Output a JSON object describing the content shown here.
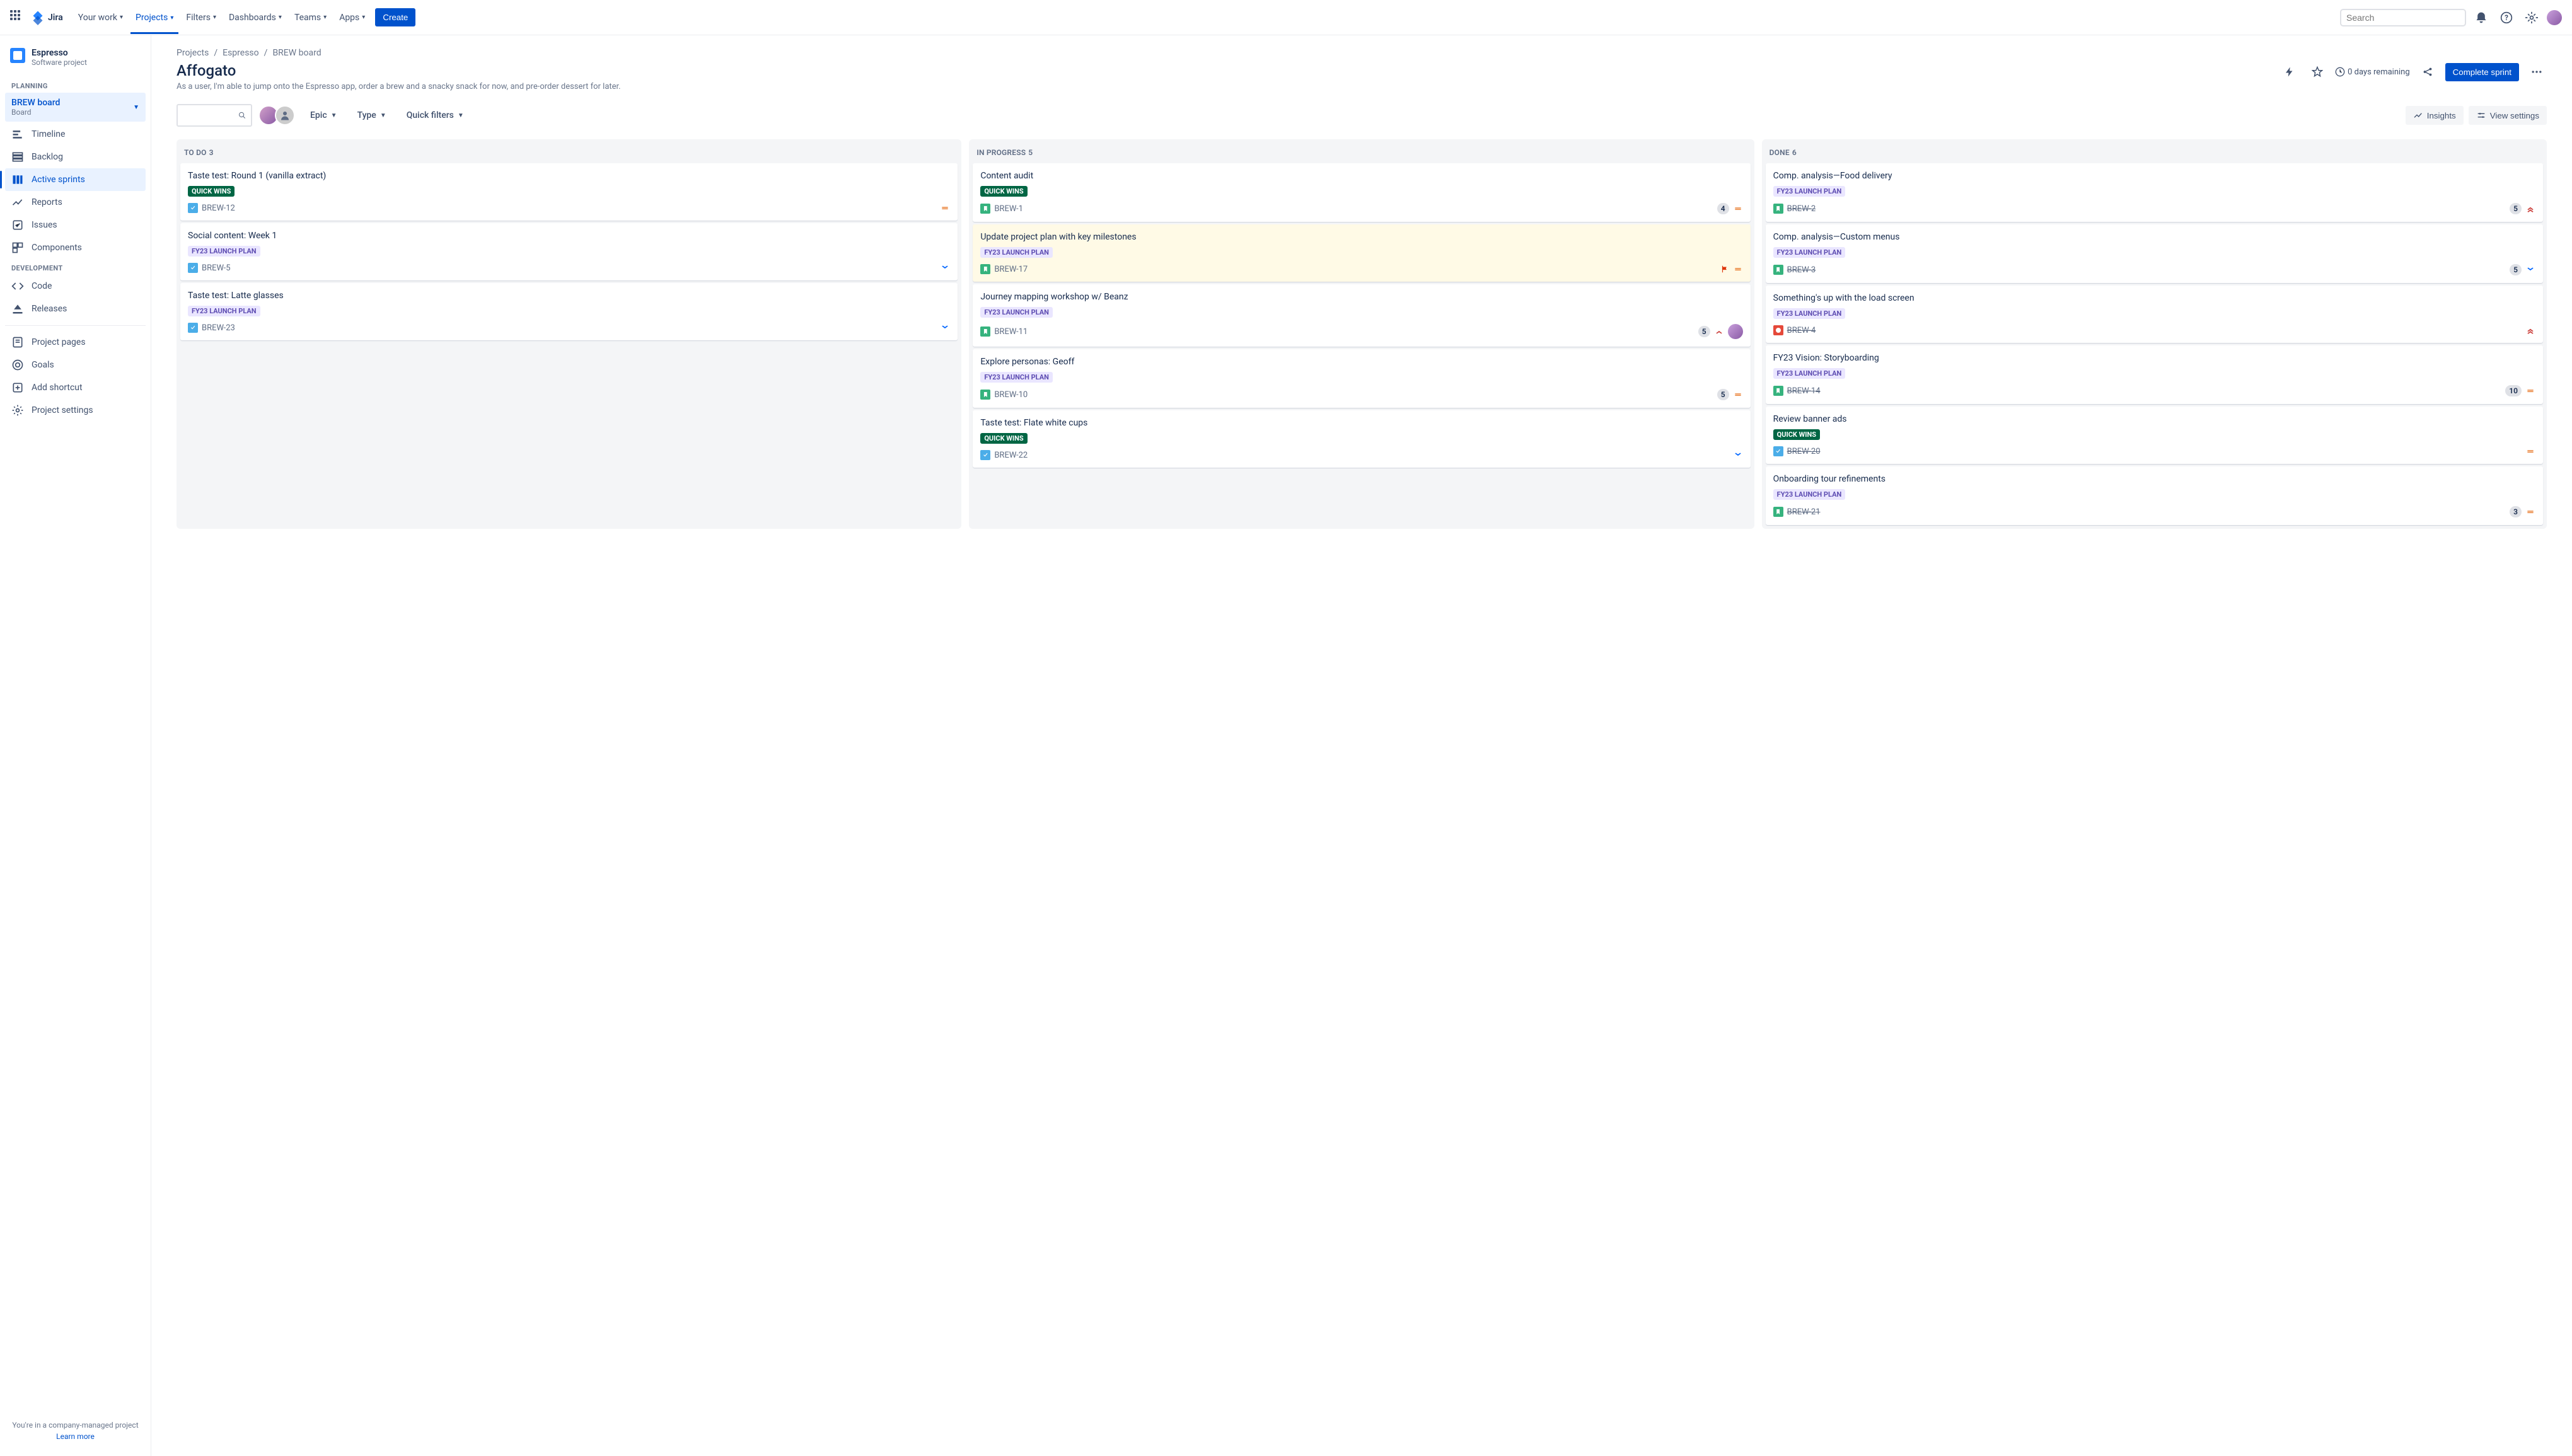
{
  "topnav": {
    "logo_text": "Jira",
    "items": [
      "Your work",
      "Projects",
      "Filters",
      "Dashboards",
      "Teams",
      "Apps"
    ],
    "active_index": 1,
    "create_label": "Create",
    "search_placeholder": "Search"
  },
  "sidebar": {
    "project_name": "Espresso",
    "project_type": "Software project",
    "sections": {
      "planning_label": "PLANNING",
      "development_label": "DEVELOPMENT"
    },
    "board_selector": {
      "name": "BREW board",
      "sub": "Board"
    },
    "planning_items": [
      "Timeline",
      "Backlog",
      "Active sprints",
      "Reports"
    ],
    "planning_active_index": 2,
    "other_items": [
      "Issues",
      "Components"
    ],
    "dev_items": [
      "Code",
      "Releases"
    ],
    "bottom_items": [
      "Project pages",
      "Goals",
      "Add shortcut",
      "Project settings"
    ],
    "footer_text": "You're in a company-managed project",
    "footer_link": "Learn more"
  },
  "header": {
    "breadcrumbs": [
      "Projects",
      "Espresso",
      "BREW board"
    ],
    "title": "Affogato",
    "description": "As a user, I'm able to jump onto the Espresso app, order a brew and a snacky snack for now, and pre-order dessert for later.",
    "remaining": "0 days remaining",
    "complete_label": "Complete sprint"
  },
  "filters": {
    "epic_label": "Epic",
    "type_label": "Type",
    "quick_label": "Quick filters",
    "insights_label": "Insights",
    "view_label": "View settings"
  },
  "tags": {
    "quick_wins": "QUICK WINS",
    "fy23": "FY23 LAUNCH PLAN"
  },
  "board": {
    "columns": [
      {
        "name": "TO DO",
        "count": 3,
        "cards": [
          {
            "title": "Taste test: Round 1 (vanilla extract)",
            "tag": "quick_wins",
            "type": "task",
            "key": "BREW-12",
            "priority": "medium"
          },
          {
            "title": "Social content: Week 1",
            "tag": "fy23",
            "type": "task",
            "key": "BREW-5",
            "priority": "low"
          },
          {
            "title": "Taste test: Latte glasses",
            "tag": "fy23",
            "type": "task",
            "key": "BREW-23",
            "priority": "low"
          }
        ]
      },
      {
        "name": "IN PROGRESS",
        "count": 5,
        "cards": [
          {
            "title": "Content audit",
            "tag": "quick_wins",
            "type": "story",
            "key": "BREW-1",
            "estimate": 4,
            "priority": "medium"
          },
          {
            "title": "Update project plan with key milestones",
            "tag": "fy23",
            "type": "story",
            "key": "BREW-17",
            "flagged": true,
            "priority": "medium"
          },
          {
            "title": "Journey mapping workshop w/ Beanz",
            "tag": "fy23",
            "type": "story",
            "key": "BREW-11",
            "estimate": 5,
            "priority": "high",
            "assignee": true
          },
          {
            "title": "Explore personas: Geoff",
            "tag": "fy23",
            "type": "story",
            "key": "BREW-10",
            "estimate": 5,
            "priority": "medium"
          },
          {
            "title": "Taste test: Flate white cups",
            "tag": "quick_wins",
            "type": "task",
            "key": "BREW-22",
            "priority": "low"
          }
        ]
      },
      {
        "name": "DONE",
        "count": 6,
        "cards": [
          {
            "title": "Comp. analysis—Food delivery",
            "tag": "fy23",
            "type": "story",
            "key": "BREW-2",
            "done": true,
            "estimate": 5,
            "priority": "highest"
          },
          {
            "title": "Comp. analysis—Custom menus",
            "tag": "fy23",
            "type": "story",
            "key": "BREW-3",
            "done": true,
            "estimate": 5,
            "priority": "low"
          },
          {
            "title": "Something's up with the load screen",
            "tag": "fy23",
            "type": "bug",
            "key": "BREW-4",
            "done": true,
            "priority": "highest"
          },
          {
            "title": "FY23 Vision: Storyboarding",
            "tag": "fy23",
            "type": "story",
            "key": "BREW-14",
            "done": true,
            "estimate": 10,
            "priority": "medium"
          },
          {
            "title": "Review banner ads",
            "tag": "quick_wins",
            "type": "task",
            "key": "BREW-20",
            "done": true,
            "priority": "medium"
          },
          {
            "title": "Onboarding tour refinements",
            "tag": "fy23",
            "type": "story",
            "key": "BREW-21",
            "done": true,
            "estimate": 3,
            "priority": "medium"
          }
        ]
      }
    ]
  }
}
